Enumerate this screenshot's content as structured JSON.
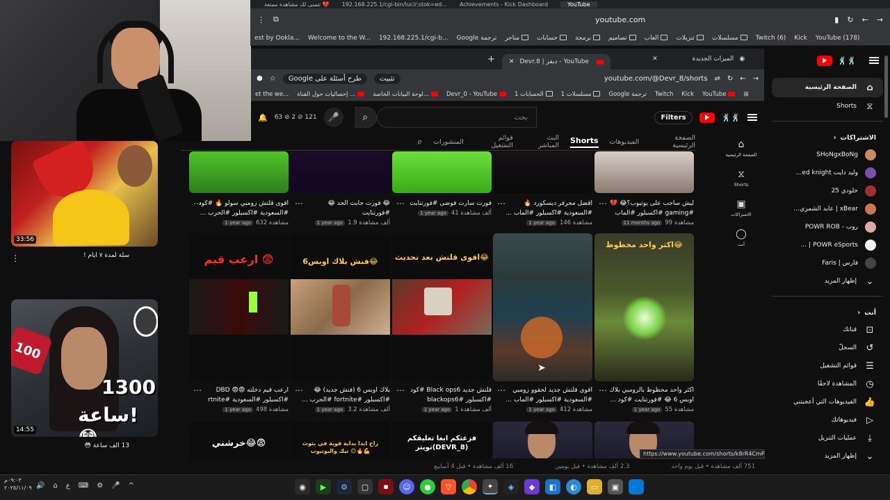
{
  "outer_browser": {
    "tabs": [
      "تتمنى لك مشاهدة ممتعة 💔",
      "192.168.225.1/cgi-bin/luci/;stok=ed...",
      "Achievements - Kick Dashboard",
      "YouTube"
    ],
    "url": "youtube.com",
    "bookmarks": [
      "est by Ookla...",
      "Welcome to the W...",
      "192.168.225.1/cgi-b...",
      "Google ترجمة",
      "متاجر",
      "حسابات",
      "برمجة",
      "تصاميم",
      "العاب",
      "تنزيلات",
      "مسلسلات",
      "Twitch (6)",
      "Kick",
      "YouTube (178)"
    ]
  },
  "left_feed": {
    "video1_duration": "33:56",
    "video1_title": "سلة لمدة ٧ ايام !",
    "video2_duration": "14:55",
    "video2_title": "13 الف ساعة 😳",
    "video2_overlay_num": "100",
    "video2_overlay_big": "1300",
    "video2_overlay_word": "ساعة!😳"
  },
  "inner_browser": {
    "tab_title": "Devr.8 | ديفر - YouTube",
    "new_tabs_label": "الميزات الجديدة",
    "url": "youtube.com/@Devr_8/shorts",
    "install_label": "تثبيت",
    "google_label": "Google طرح أسئلة على",
    "bookmarks": [
      "et the we...",
      "إحصائيات حول القناة ...",
      "لوحة البيانات الخاصة...",
      "Devr_0 - YouTube",
      "الحسابات 1",
      "مسلسلات 1",
      "Google ترجمة",
      "Twitch",
      "Kick",
      "YouTube"
    ],
    "search_placeholder": "بحث",
    "filters_label": "Filters",
    "stats": {
      "a": "63",
      "b": "2",
      "c": "121"
    },
    "channel_tabs": [
      "الصفحة الرئيسية",
      "الفيديوهات",
      "Shorts",
      "البث المباشر",
      "قوائم التشغيل",
      "المنشورات"
    ],
    "rail": [
      "الصفحة الرئيسية",
      "Shorts",
      "الاشتراكات",
      "أنت"
    ],
    "status_url": "https://www.youtube.com/shorts/k8rR4CmPDDE"
  },
  "shorts": {
    "row1": [
      {
        "t1": "اقوى قلتش زومبي سولو 🔥 #كود",
        "t2": "#السعودية #اكسبلور #الحرب ...",
        "views": "632 مشاهدة",
        "ago": "1 year ago"
      },
      {
        "t1": "😂 فورت جابت الجد 😂",
        "t2": "#فورتنايت",
        "views": "1.9 ألف مشاهدة",
        "ago": "1 year ago"
      },
      {
        "t1": "فورت سارت فوضى #فورتنايت",
        "t2": "",
        "views": "41 ألف مشاهدة",
        "ago": "1 year ago"
      },
      {
        "t1": "اقضل مجرفر ديسكورد 🔥",
        "t2": "#السعودية #اكسبلور #الماب ...",
        "views": "146 مشاهدة",
        "ago": "1 year ago"
      },
      {
        "t1": "ليش ساحب على يوتيوب؟😂 💔",
        "t2": "#gaming #اكسبلور #الماب",
        "views": "99 مشاهدة",
        "ago": "11 months ago"
      }
    ],
    "row2": [
      {
        "label": "ارعب قيم 😨",
        "t1": "ارعب قيم دخلته 😨😨 DBD",
        "t2": "#اكسبلور #السعودية #rtnite",
        "views": "498 مشاهدة",
        "ago": "1 year ago"
      },
      {
        "label": "فنش بلاك اوبس6😂",
        "t1": "بلاك اوبس 6 (فنش جديد) 😂",
        "t2": "#اكسبلور #fortnite #الحرب ...",
        "views": "3.2 ألف مشاهدة",
        "ago": "1 year ago"
      },
      {
        "label": "اقوى قلتش بعد تحديث😂",
        "t1": "قلتش جديد Black ops6 #كود",
        "t2": "#اكسبلور #blackops6",
        "views": "1 ألف مشاهدة",
        "ago": "1 year ago"
      },
      {
        "label": "",
        "t1": "اقوى قلتش جديد لحقوو زومبي",
        "t2": "#السعودية #اكسبلور #الماب ...",
        "views": "412 مشاهدة",
        "ago": "1 year ago"
      },
      {
        "label": "اكثر واحد مخظوظ😂",
        "t1": "اكثر واحد محظوظ بالزومبي بلاك",
        "t2": "اوبس 6 😂 #فورتنايت #كود ...",
        "views": "55 مشاهدة",
        "ago": "1 year ago"
      }
    ],
    "row3": [
      {
        "label": "خرشني😂😨"
      },
      {
        "label": "راح ابدا بداية قوية في بثوث تيك واليوتيوب 😊🔥💪"
      },
      {
        "label": "فزعتكم ابغا تعليقكم تويتر(DEVR_8)"
      },
      {
        "label": ""
      },
      {
        "label": ""
      }
    ],
    "under_strip": [
      "751 ألف مشاهدة • قبل يوم واحد",
      "2.3 ألف مشاهدة • قبل يومين",
      "16 ألف مشاهدة • قبل 4 أسابيع"
    ]
  },
  "right_sidebar": {
    "home": "الصفحة الرئيسية",
    "shorts": "Shorts",
    "subs_header": "الاشتراكات",
    "subs": [
      {
        "name": "SHoNgxBoNg",
        "color": "#c98a6a"
      },
      {
        "name": "وليد دايت ed knight…",
        "color": "#7a4fb0"
      },
      {
        "name": "خلودي 25",
        "color": "#a03030"
      },
      {
        "name": "xBear | عابد الشمري…",
        "color": "#cc7755"
      },
      {
        "name": "روب - POWR ROB",
        "color": "#ddaaaa"
      },
      {
        "name": "POWR eSports | …",
        "color": "#eeeeee"
      },
      {
        "name": "فارس | Faris",
        "color": "#444444"
      }
    ],
    "show_more": "إظهار المزيد",
    "you_header": "أنت",
    "you_items": [
      {
        "label": "قناتك",
        "icon": "user-box-icon"
      },
      {
        "label": "السجلّ",
        "icon": "history-icon"
      },
      {
        "label": "قوائم التشغيل",
        "icon": "playlist-icon"
      },
      {
        "label": "المشاهدة لاحقًا",
        "icon": "clock-icon"
      },
      {
        "label": "الفيديوهات التي أعجبتني",
        "icon": "like-icon"
      },
      {
        "label": "فيديوهاتك",
        "icon": "video-icon"
      },
      {
        "label": "عمليات التنزيل",
        "icon": "download-icon"
      }
    ],
    "show_more_2": "إظهار المزيد"
  },
  "taskbar": {
    "time": "٠٩:٠٣م",
    "date": "٢٠٢٥/١١/٠٩",
    "lang": "ع"
  }
}
